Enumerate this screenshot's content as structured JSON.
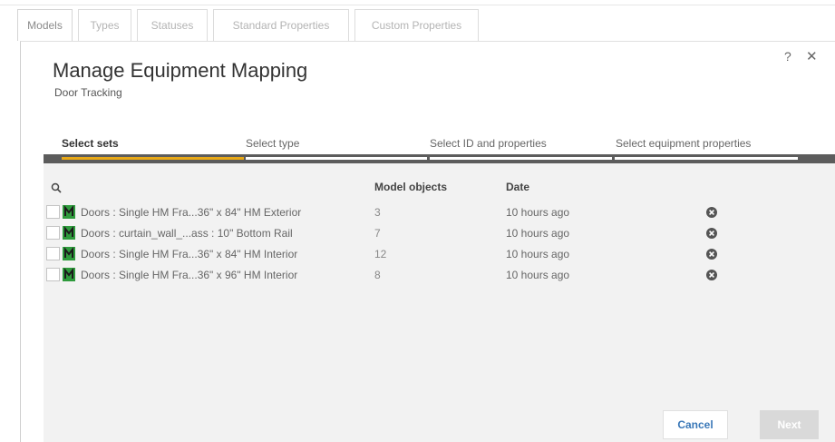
{
  "tabs": [
    {
      "label": "Models"
    },
    {
      "label": "Types"
    },
    {
      "label": "Statuses"
    },
    {
      "label": "Standard Properties"
    },
    {
      "label": "Custom Properties"
    }
  ],
  "dialog": {
    "title": "Manage Equipment Mapping",
    "subtitle": "Door Tracking",
    "help_label": "?",
    "close_label": "✕"
  },
  "steps": [
    {
      "label": "Select sets",
      "active": true
    },
    {
      "label": "Select type",
      "active": false
    },
    {
      "label": "Select ID and properties",
      "active": false
    },
    {
      "label": "Select equipment properties",
      "active": false
    }
  ],
  "table": {
    "columns": {
      "model_objects": "Model objects",
      "date": "Date"
    },
    "rows": [
      {
        "name": "Doors : Single HM Fra...36\" x 84\" HM Exterior",
        "count": "3",
        "date": "10 hours ago"
      },
      {
        "name": "Doors : curtain_wall_...ass : 10\" Bottom Rail",
        "count": "7",
        "date": "10 hours ago"
      },
      {
        "name": "Doors : Single HM Fra...36\" x 84\" HM Interior",
        "count": "12",
        "date": "10 hours ago"
      },
      {
        "name": "Doors : Single HM Fra...36\" x 96\" HM Interior",
        "count": "8",
        "date": "10 hours ago"
      }
    ]
  },
  "buttons": {
    "cancel": "Cancel",
    "next": "Next"
  },
  "colors": {
    "accent": "#e8a817",
    "step_bar": "#5c5c5c",
    "model_icon": "#2e9a3c",
    "link": "#3a78b8"
  }
}
